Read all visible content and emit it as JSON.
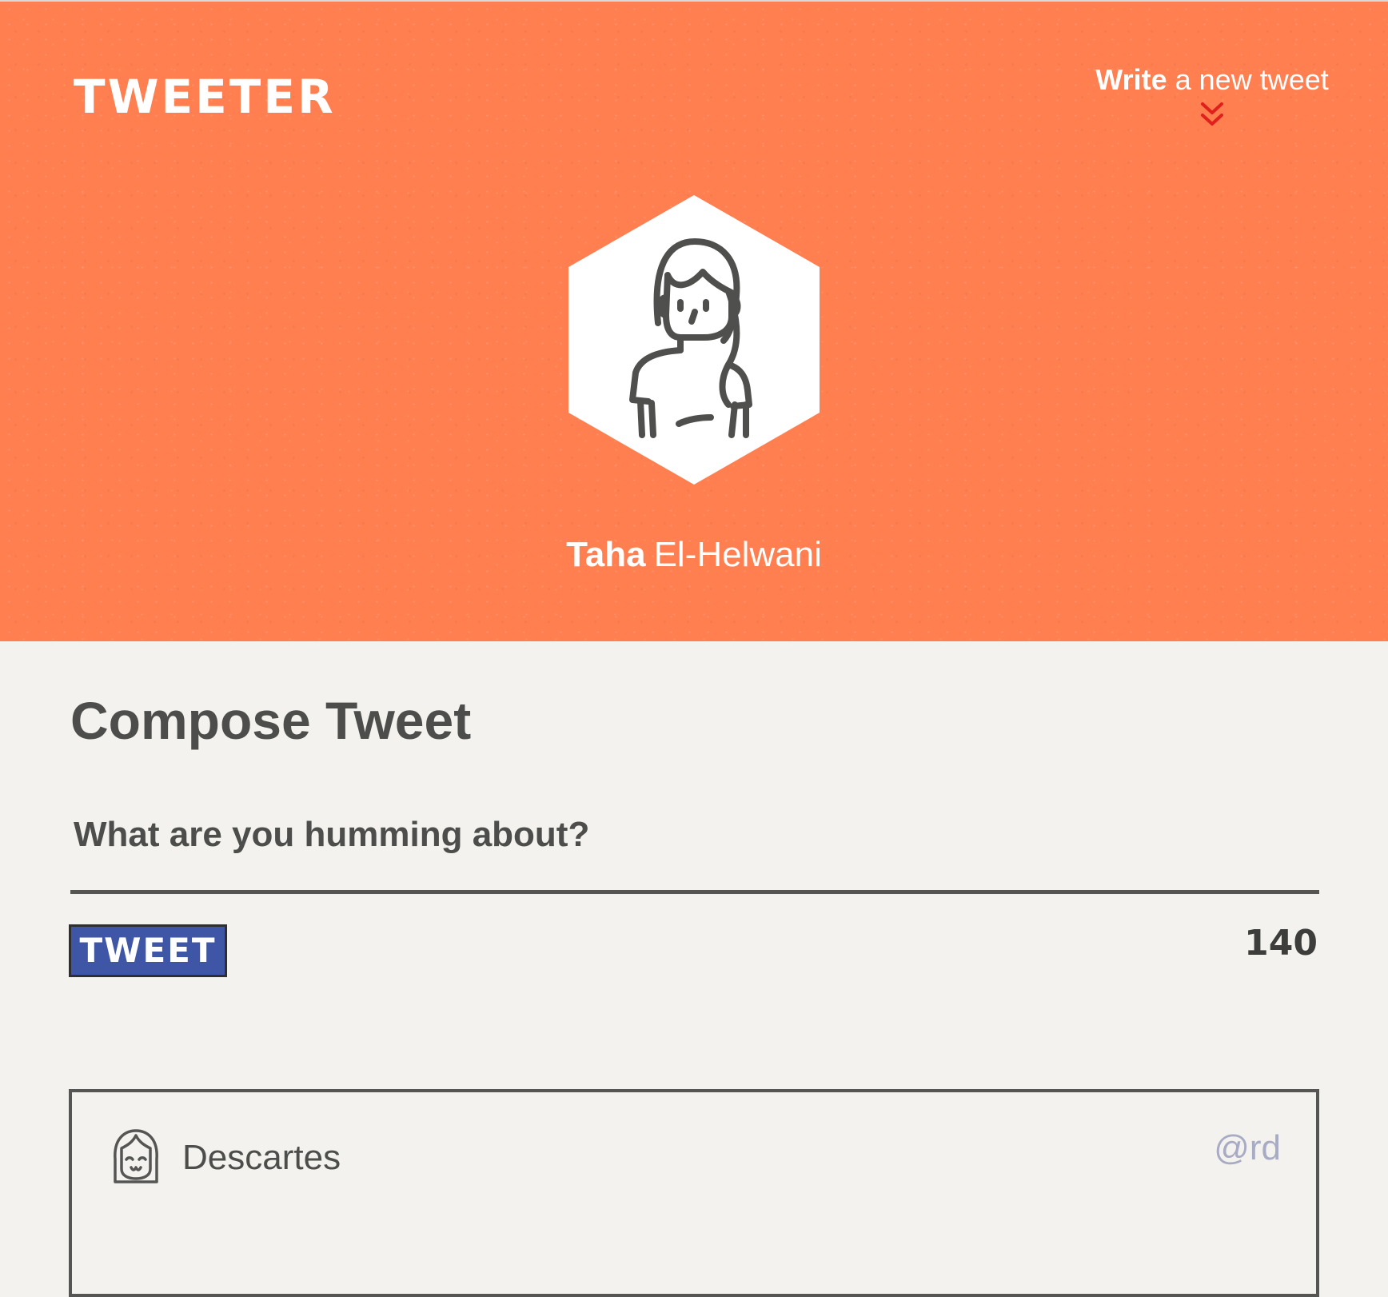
{
  "app": {
    "brand": "TWEETER"
  },
  "nav": {
    "write_strong": "Write",
    "write_rest": "a new tweet"
  },
  "profile": {
    "first_name": "Taha",
    "last_name": "El-Helwani",
    "avatar_icon": "woman-avatar-icon"
  },
  "compose": {
    "title": "Compose Tweet",
    "placeholder": "What are you humming about?",
    "value": "",
    "button_label": "TWEET",
    "char_count": "140"
  },
  "tweets": [
    {
      "name": "Descartes",
      "handle": "@rd",
      "avatar_icon": "girl-avatar-icon"
    }
  ],
  "colors": {
    "header_bg": "#ff7f50",
    "page_bg": "#f3f2ee",
    "button_bg": "#3e56a5",
    "chevron": "#e0201a",
    "handle": "#a8abc4",
    "text_dark": "#4d4d4b"
  }
}
